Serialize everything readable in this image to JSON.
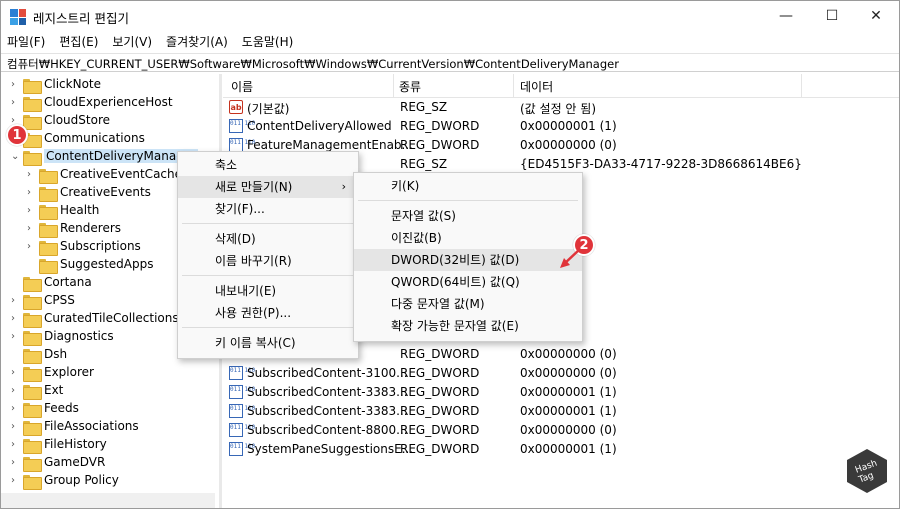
{
  "window": {
    "title": "레지스트리 편집기",
    "min_glyph": "—",
    "max_glyph": "☐",
    "close_glyph": "✕"
  },
  "menu": [
    "파일(F)",
    "편집(E)",
    "보기(V)",
    "즐겨찾기(A)",
    "도움말(H)"
  ],
  "address": "컴퓨터₩HKEY_CURRENT_USER₩Software₩Microsoft₩Windows₩CurrentVersion₩ContentDeliveryManager",
  "tree": [
    {
      "label": "ClickNote",
      "indent": 0,
      "chevron": "›"
    },
    {
      "label": "CloudExperienceHost",
      "indent": 0,
      "chevron": "›"
    },
    {
      "label": "CloudStore",
      "indent": 0,
      "chevron": "›"
    },
    {
      "label": "Communications",
      "indent": 0,
      "chevron": ""
    },
    {
      "label": "ContentDeliveryManager",
      "indent": 0,
      "chevron": "⌄",
      "selected": true
    },
    {
      "label": "CreativeEventCache",
      "indent": 1,
      "chevron": "›"
    },
    {
      "label": "CreativeEvents",
      "indent": 1,
      "chevron": "›"
    },
    {
      "label": "Health",
      "indent": 1,
      "chevron": "›"
    },
    {
      "label": "Renderers",
      "indent": 1,
      "chevron": "›"
    },
    {
      "label": "Subscriptions",
      "indent": 1,
      "chevron": "›"
    },
    {
      "label": "SuggestedApps",
      "indent": 1,
      "chevron": ""
    },
    {
      "label": "Cortana",
      "indent": 0,
      "chevron": ""
    },
    {
      "label": "CPSS",
      "indent": 0,
      "chevron": "›"
    },
    {
      "label": "CuratedTileCollections",
      "indent": 0,
      "chevron": "›"
    },
    {
      "label": "Diagnostics",
      "indent": 0,
      "chevron": "›"
    },
    {
      "label": "Dsh",
      "indent": 0,
      "chevron": ""
    },
    {
      "label": "Explorer",
      "indent": 0,
      "chevron": "›"
    },
    {
      "label": "Ext",
      "indent": 0,
      "chevron": "›"
    },
    {
      "label": "Feeds",
      "indent": 0,
      "chevron": "›"
    },
    {
      "label": "FileAssociations",
      "indent": 0,
      "chevron": "›"
    },
    {
      "label": "FileHistory",
      "indent": 0,
      "chevron": "›"
    },
    {
      "label": "GameDVR",
      "indent": 0,
      "chevron": "›"
    },
    {
      "label": "Group Policy",
      "indent": 0,
      "chevron": "›"
    }
  ],
  "columns": [
    "이름",
    "종류",
    "데이터"
  ],
  "rows": [
    {
      "name": "(기본값)",
      "type": "REG_SZ",
      "data": "(값 설정 안 됨)",
      "icon": "str",
      "icon_glyph": "ab"
    },
    {
      "name": "ContentDeliveryAllowed",
      "type": "REG_DWORD",
      "data": "0x00000001 (1)",
      "icon": "bin",
      "icon_glyph": "011\n110"
    },
    {
      "name": "FeatureManagementEnab...",
      "type": "REG_DWORD",
      "data": "0x00000000 (0)",
      "icon": "bin",
      "icon_glyph": "011\n110"
    },
    {
      "name": "",
      "type": "REG_SZ",
      "data": "{ED4515F3-DA33-4717-9228-3D8668614BE6}",
      "icon": "",
      "icon_glyph": ""
    },
    {
      "name": "",
      "type": "",
      "data": "1)",
      "icon": "",
      "icon_glyph": ""
    },
    {
      "name": "",
      "type": "",
      "data": "1)",
      "icon": "",
      "icon_glyph": ""
    },
    {
      "name": "",
      "type": "",
      "data": "1)",
      "icon": "",
      "icon_glyph": ""
    },
    {
      "name": "",
      "type": "",
      "data": "1)",
      "icon": "",
      "icon_glyph": ""
    },
    {
      "name": "",
      "type": "",
      "data": "1)",
      "icon": "",
      "icon_glyph": ""
    },
    {
      "name": "",
      "type": "",
      "data": "1)",
      "icon": "",
      "icon_glyph": ""
    },
    {
      "name": "",
      "type": "",
      "data": "1)",
      "icon": "",
      "icon_glyph": ""
    },
    {
      "name": "",
      "type": "",
      "data": "0)",
      "icon": "",
      "icon_glyph": ""
    },
    {
      "name": "",
      "type": "",
      "data": "0)",
      "icon": "",
      "icon_glyph": ""
    },
    {
      "name": "808...",
      "type": "REG_DWORD",
      "data": "0x00000000 (0)",
      "icon": "",
      "icon_glyph": ""
    },
    {
      "name": "SubscribedContent-3100...",
      "type": "REG_DWORD",
      "data": "0x00000000 (0)",
      "icon": "bin",
      "icon_glyph": "011\n110"
    },
    {
      "name": "SubscribedContent-3383...",
      "type": "REG_DWORD",
      "data": "0x00000001 (1)",
      "icon": "bin",
      "icon_glyph": "011\n110"
    },
    {
      "name": "SubscribedContent-3383...",
      "type": "REG_DWORD",
      "data": "0x00000001 (1)",
      "icon": "bin",
      "icon_glyph": "011\n110"
    },
    {
      "name": "SubscribedContent-8800...",
      "type": "REG_DWORD",
      "data": "0x00000000 (0)",
      "icon": "bin",
      "icon_glyph": "011\n110"
    },
    {
      "name": "SystemPaneSuggestionsE...",
      "type": "REG_DWORD",
      "data": "0x00000001 (1)",
      "icon": "bin",
      "icon_glyph": "011\n110"
    }
  ],
  "context_menu": {
    "items": [
      {
        "label": "축소"
      },
      {
        "label": "새로 만들기(N)",
        "arrow": "›",
        "highlighted": true
      },
      {
        "label": "찾기(F)..."
      },
      {
        "sep": true
      },
      {
        "label": "삭제(D)"
      },
      {
        "label": "이름 바꾸기(R)"
      },
      {
        "sep": true
      },
      {
        "label": "내보내기(E)"
      },
      {
        "label": "사용 권한(P)..."
      },
      {
        "sep": true
      },
      {
        "label": "키 이름 복사(C)"
      }
    ]
  },
  "submenu": {
    "items": [
      {
        "label": "키(K)"
      },
      {
        "sep": true
      },
      {
        "label": "문자열 값(S)"
      },
      {
        "label": "이진값(B)"
      },
      {
        "label": "DWORD(32비트) 값(D)",
        "highlighted": true
      },
      {
        "label": "QWORD(64비트) 값(Q)"
      },
      {
        "label": "다중 문자열 값(M)"
      },
      {
        "label": "확장 가능한 문자열 값(E)"
      }
    ]
  },
  "annotations": {
    "badge1": "1",
    "badge2": "2",
    "accent": "#e0343a"
  },
  "watermark": {
    "line1": "Hash",
    "line2": "Tag"
  }
}
